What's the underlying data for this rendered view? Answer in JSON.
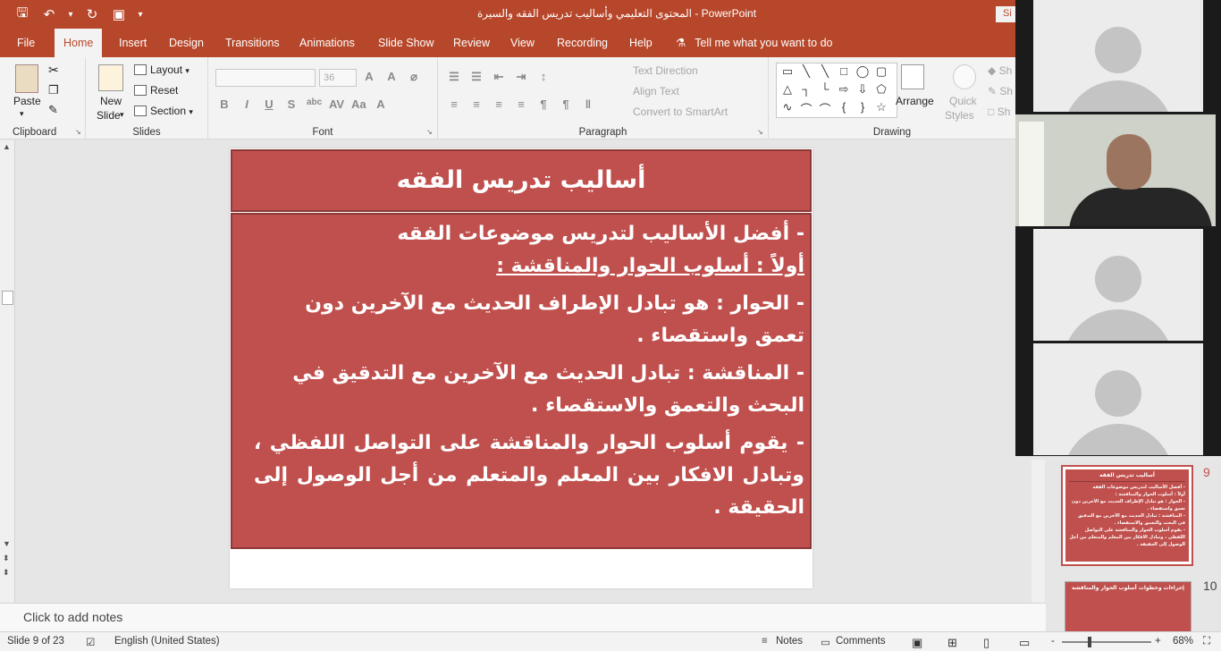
{
  "window": {
    "title": "المحتوى التعليمي وأساليب تدريس الفقه والسيرة  -  PowerPoint",
    "signin": "Si"
  },
  "tabs": [
    "File",
    "Home",
    "Insert",
    "Design",
    "Transitions",
    "Animations",
    "Slide Show",
    "Review",
    "View",
    "Recording",
    "Help"
  ],
  "active_tab": "Home",
  "tellme": "Tell me what you want to do",
  "ribbon": {
    "clipboard": {
      "label": "Clipboard",
      "paste": "Paste"
    },
    "slides": {
      "label": "Slides",
      "new_slide_1": "New",
      "new_slide_2": "Slide",
      "layout": "Layout",
      "reset": "Reset",
      "section": "Section"
    },
    "font": {
      "label": "Font",
      "size": "36"
    },
    "paragraph": {
      "label": "Paragraph",
      "text_direction": "Text Direction",
      "align_text": "Align Text",
      "convert_smartart": "Convert to SmartArt"
    },
    "drawing": {
      "label": "Drawing",
      "arrange": "Arrange",
      "quick_styles_1": "Quick",
      "quick_styles_2": "Styles",
      "shape_fill": "Sh",
      "shape_outline": "Sh",
      "shape_effects": "Sh"
    }
  },
  "slide": {
    "title": "أساليب تدريس الفقه",
    "lines": [
      "- أفضل الأساليب لتدريس موضوعات الفقه",
      "أولاً : أسلوب الحوار والمناقشة :",
      "- الحوار : هو تبادل الإطراف الحديث مع الآخرين دون تعمق واستقصاء .",
      "- المناقشة : تبادل الحديث مع الآخرين مع التدقيق في البحث والتعمق والاستقصاء .",
      "- يقوم أسلوب الحوار والمناقشة على التواصل اللفظي ، وتبادل الافكار بين المعلم والمتعلم من أجل الوصول إلى الحقيقة ."
    ]
  },
  "thumbnails": [
    {
      "number": "9",
      "title": "أساليب تدريس الفقه",
      "selected": true
    },
    {
      "number": "10",
      "title": "إجراءات وخطوات أسلوب الحوار والمناقشة",
      "selected": false
    }
  ],
  "notes_placeholder": "Click to add notes",
  "status": {
    "slide_info": "Slide 9 of 23",
    "language": "English (United States)",
    "notes": "Notes",
    "comments": "Comments",
    "zoom": "68%",
    "minus": "-",
    "plus": "+"
  },
  "colors": {
    "accent": "#b7472a",
    "slide_fill": "#c0504d"
  },
  "video": {
    "participants": 4
  }
}
